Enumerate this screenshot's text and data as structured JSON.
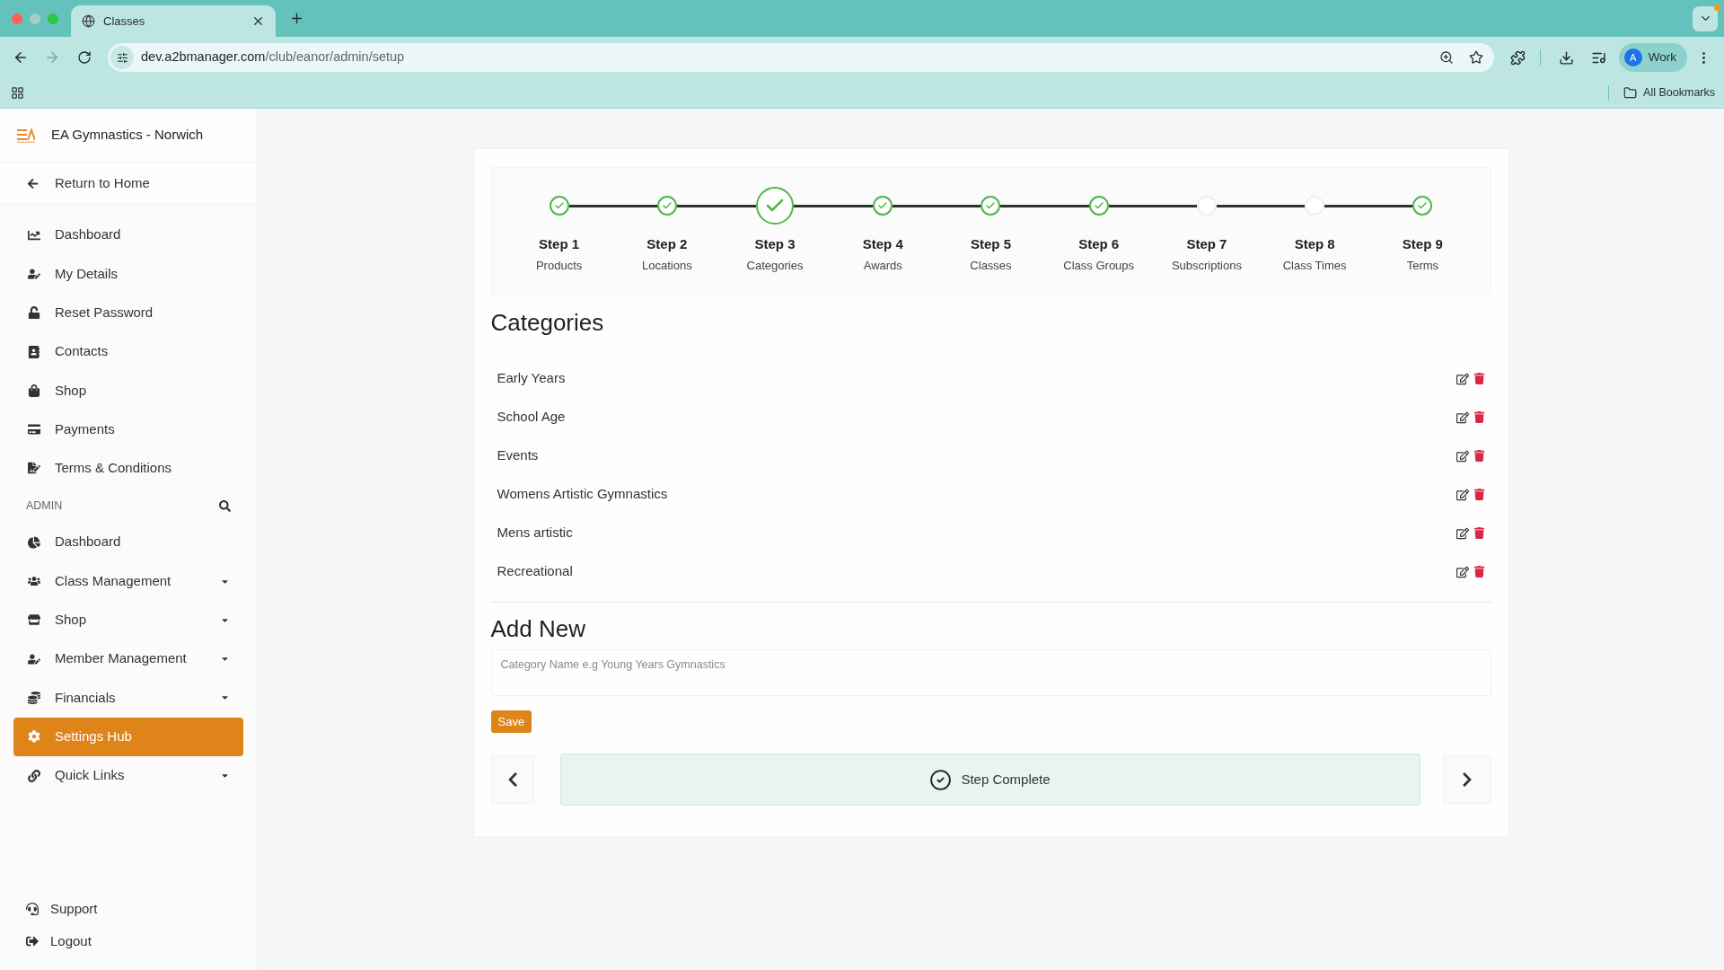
{
  "browser": {
    "tab": {
      "title": "Classes"
    },
    "forward_button": {
      "disabled": true
    },
    "address_bar": {
      "domain": "dev.a2bmanager.com",
      "path": "/club/eanor/admin/setup"
    },
    "profile": {
      "initial": "A",
      "label": "Work"
    },
    "bookmarks_bar": {
      "all_bookmarks": "All Bookmarks"
    }
  },
  "sidebar": {
    "club_name": "EA Gymnastics - Norwich",
    "return_link": "Return to Home",
    "items": [
      {
        "label": "Dashboard",
        "selected": false
      },
      {
        "label": "My Details",
        "selected": false
      },
      {
        "label": "Reset Password",
        "selected": false
      },
      {
        "label": "Contacts",
        "selected": false
      },
      {
        "label": "Shop",
        "selected": false
      },
      {
        "label": "Payments",
        "selected": false
      },
      {
        "label": "Terms & Conditions",
        "selected": false
      }
    ],
    "admin": {
      "heading": "ADMIN",
      "items": [
        {
          "label": "Dashboard",
          "has_submenu": false,
          "selected": false
        },
        {
          "label": "Class Management",
          "has_submenu": true,
          "selected": false
        },
        {
          "label": "Shop",
          "has_submenu": true,
          "selected": false
        },
        {
          "label": "Member Management",
          "has_submenu": true,
          "selected": false
        },
        {
          "label": "Financials",
          "has_submenu": true,
          "selected": false
        },
        {
          "label": "Settings Hub",
          "has_submenu": false,
          "selected": true
        },
        {
          "label": "Quick Links",
          "has_submenu": true,
          "selected": false
        }
      ]
    },
    "footer_items": [
      {
        "label": "Support",
        "selected": false
      },
      {
        "label": "Logout",
        "selected": false
      }
    ]
  },
  "stepper": {
    "steps": [
      {
        "title": "Step 1",
        "name": "Products",
        "done": true,
        "selected": false
      },
      {
        "title": "Step 2",
        "name": "Locations",
        "done": true,
        "selected": false
      },
      {
        "title": "Step 3",
        "name": "Categories",
        "done": true,
        "selected": true
      },
      {
        "title": "Step 4",
        "name": "Awards",
        "done": true,
        "selected": false
      },
      {
        "title": "Step 5",
        "name": "Classes",
        "done": true,
        "selected": false
      },
      {
        "title": "Step 6",
        "name": "Class Groups",
        "done": true,
        "selected": false
      },
      {
        "title": "Step 7",
        "name": "Subscriptions",
        "done": false,
        "selected": false
      },
      {
        "title": "Step 8",
        "name": "Class Times",
        "done": false,
        "selected": false
      },
      {
        "title": "Step 9",
        "name": "Terms",
        "done": true,
        "selected": false
      }
    ]
  },
  "categories": {
    "title": "Categories",
    "items": [
      {
        "name": "Early Years"
      },
      {
        "name": "School Age"
      },
      {
        "name": "Events"
      },
      {
        "name": "Womens Artistic Gymnastics"
      },
      {
        "name": "Mens artistic"
      },
      {
        "name": "Recreational"
      }
    ]
  },
  "add_new": {
    "title": "Add New",
    "placeholder": "Category Name e.g Young Years Gymnastics",
    "save_button": "Save"
  },
  "step_navigation": {
    "status": "Step Complete"
  }
}
